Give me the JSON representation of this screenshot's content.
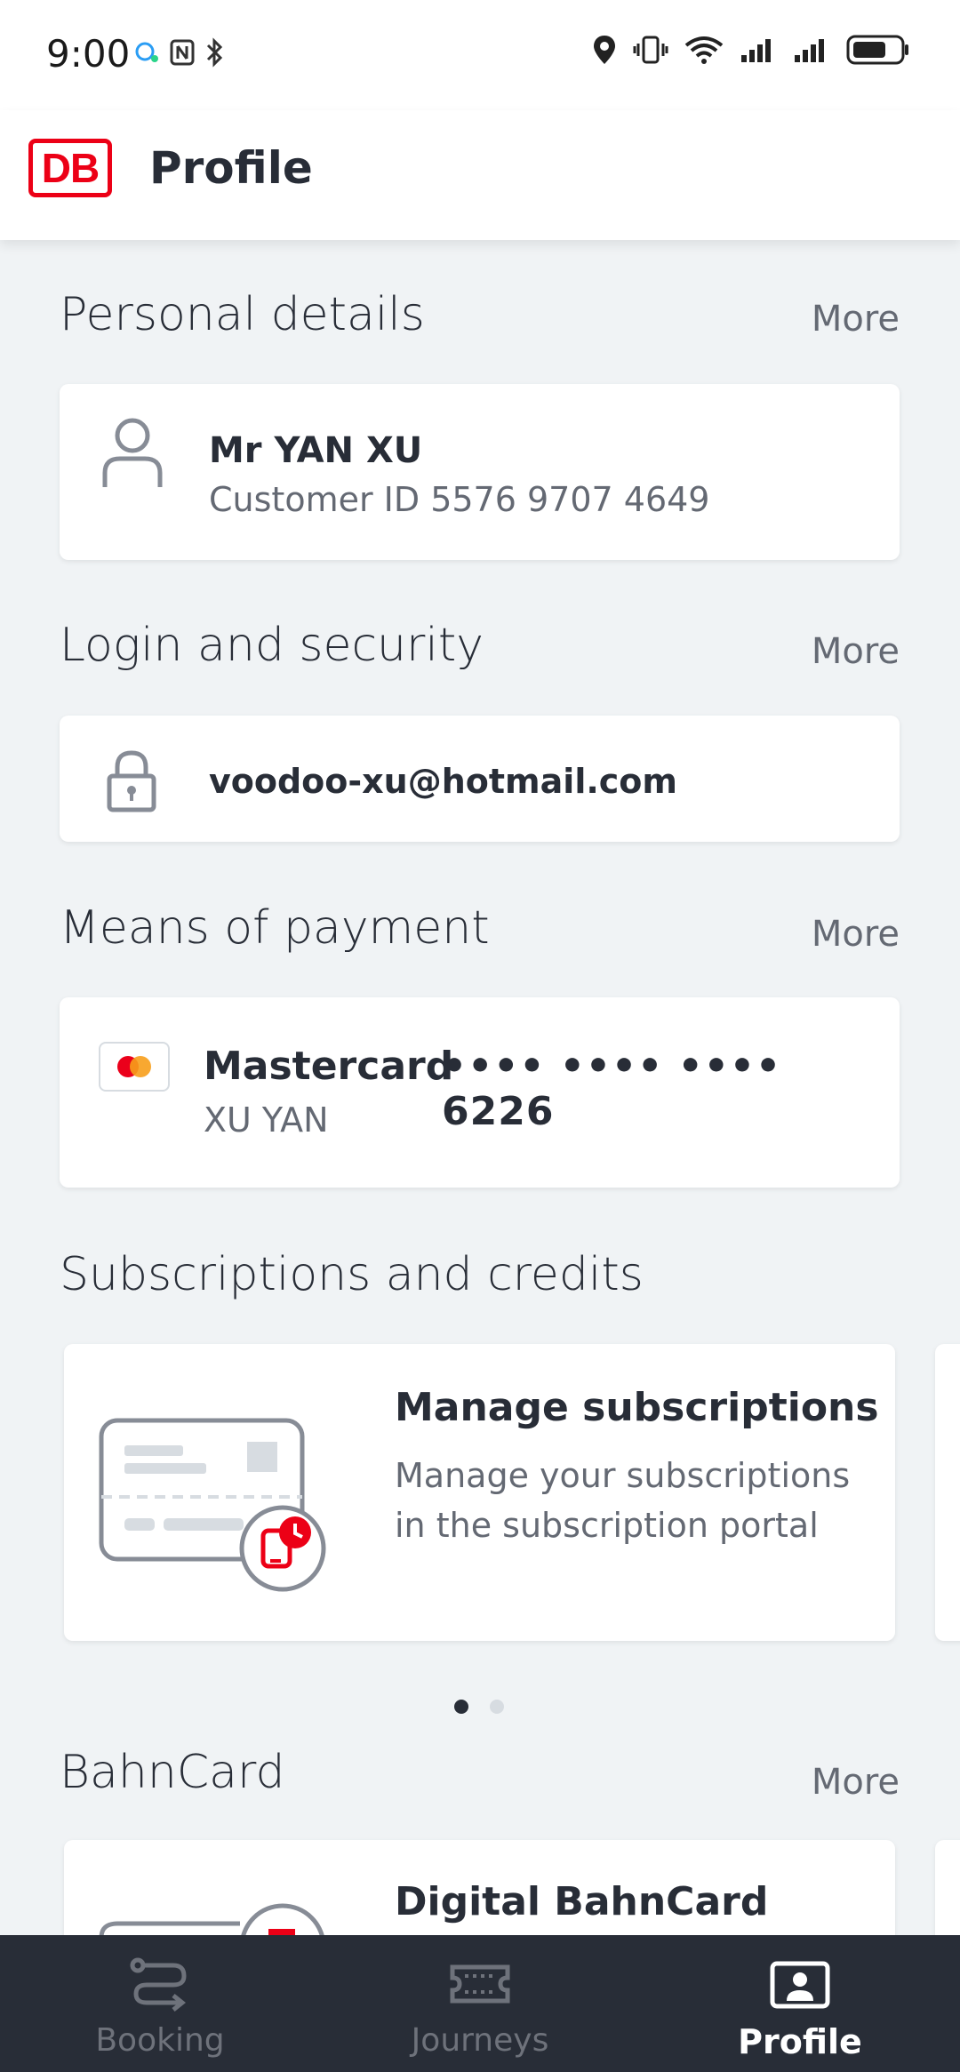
{
  "status_bar": {
    "time": "9:00"
  },
  "header": {
    "title": "Profile",
    "logo_text": "DB"
  },
  "personal_details": {
    "title": "Personal details",
    "more": "More",
    "name": "Mr YAN XU",
    "customer_id": "Customer ID 5576 9707 4649"
  },
  "login_security": {
    "title": "Login and security",
    "more": "More",
    "email": "voodoo-xu@hotmail.com"
  },
  "payment": {
    "title": "Means of payment",
    "more": "More",
    "brand": "Mastercard",
    "number": "•••• •••• •••• 6226",
    "holder": "XU YAN"
  },
  "subscriptions": {
    "title": "Subscriptions and credits",
    "card_title": "Manage subscriptions",
    "card_desc": "Manage your subscriptions in the subscription portal",
    "page_count": 2,
    "active_page": 1
  },
  "bahncard": {
    "title": "BahnCard",
    "more": "More",
    "card_title": "Digital BahnCard"
  },
  "bottom_nav": {
    "items": [
      {
        "label": "Booking",
        "icon": "route-icon",
        "active": false
      },
      {
        "label": "Journeys",
        "icon": "ticket-icon",
        "active": false
      },
      {
        "label": "Profile",
        "icon": "profile-card-icon",
        "active": true
      }
    ]
  },
  "colors": {
    "brand_red": "#ec0016",
    "text_primary": "#282d37",
    "text_secondary": "#646973",
    "background": "#f0f3f5",
    "nav_background": "#282d37"
  }
}
